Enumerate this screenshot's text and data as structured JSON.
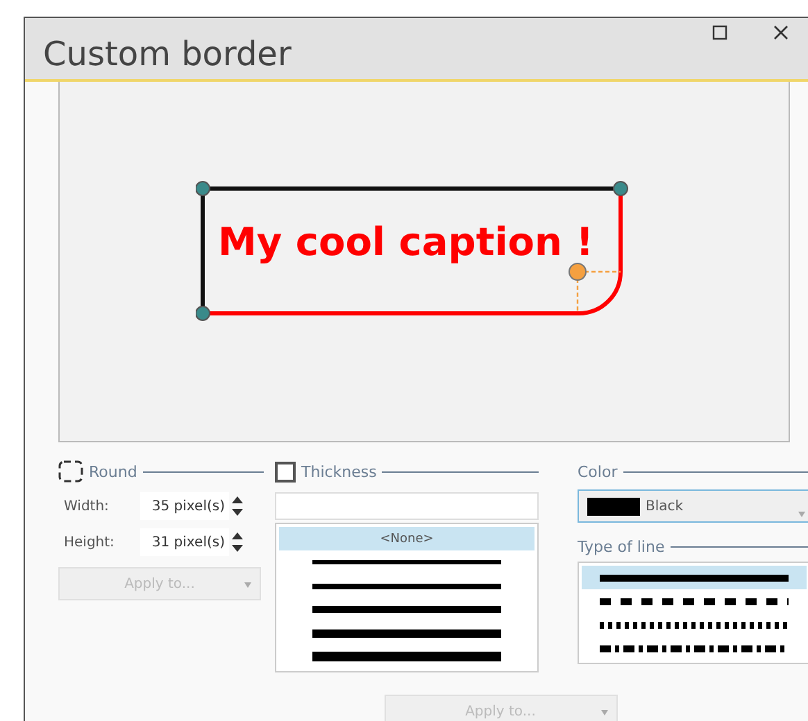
{
  "window": {
    "title": "Custom border"
  },
  "preview": {
    "caption": "My cool caption !"
  },
  "round": {
    "label": "Round",
    "width_label": "Width:",
    "width_value": "35 pixel(s)",
    "height_label": "Height:",
    "height_value": "31 pixel(s)",
    "apply": {
      "label": "Apply to...",
      "disabled": true
    }
  },
  "thickness": {
    "label": "Thickness",
    "checked": false,
    "items": [
      {
        "kind": "none",
        "label": "<None>",
        "selected": true
      },
      {
        "kind": "line",
        "selected": false
      },
      {
        "kind": "line",
        "selected": false
      },
      {
        "kind": "line",
        "selected": false
      },
      {
        "kind": "line",
        "selected": false
      },
      {
        "kind": "line",
        "selected": false
      }
    ]
  },
  "color": {
    "label": "Color",
    "color": "#000000",
    "value": "Black"
  },
  "line_type": {
    "label": "Type of line",
    "items": [
      {
        "kind": "solid",
        "selected": true
      },
      {
        "kind": "dash",
        "selected": false
      },
      {
        "kind": "dot",
        "selected": false
      },
      {
        "kind": "dashdot",
        "selected": false
      }
    ]
  },
  "apply": {
    "label": "Apply to...",
    "disabled": true
  }
}
